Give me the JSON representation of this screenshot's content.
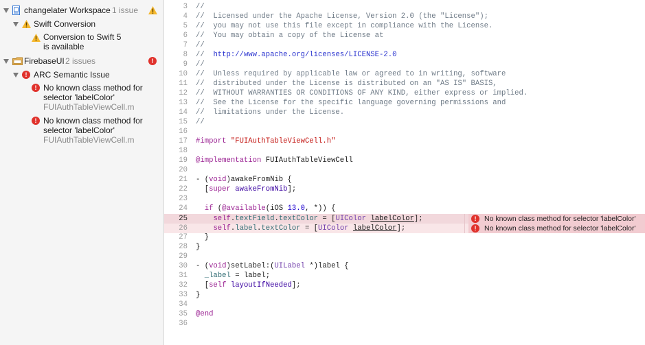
{
  "navigator": {
    "workspace": {
      "name": "changelater Workspace",
      "count": "1 issue"
    },
    "swift_group": {
      "label": "Swift Conversion"
    },
    "swift_item": {
      "line1": "Conversion to Swift 5",
      "line2": "is available"
    },
    "firebase": {
      "name": "FirebaseUI",
      "count": "2 issues"
    },
    "arc_group": {
      "label": "ARC Semantic Issue"
    },
    "issues": [
      {
        "line1": "No known class method for",
        "line2": "selector 'labelColor'",
        "file": "FUIAuthTableViewCell.m"
      },
      {
        "line1": "No known class method for",
        "line2": "selector 'labelColor'",
        "file": "FUIAuthTableViewCell.m"
      }
    ]
  },
  "editor": {
    "lines": [
      "3",
      "4",
      "5",
      "6",
      "7",
      "8",
      "9",
      "10",
      "11",
      "12",
      "13",
      "14",
      "15",
      "16",
      "17",
      "18",
      "19",
      "20",
      "21",
      "22",
      "23",
      "24",
      "25",
      "26",
      "27",
      "28",
      "29",
      "30",
      "31",
      "32",
      "33",
      "34",
      "35",
      "36"
    ],
    "code": {
      "l3": "//",
      "l4": "//  Licensed under the Apache License, Version 2.0 (the \"License\");",
      "l5": "//  you may not use this file except in compliance with the License.",
      "l6": "//  You may obtain a copy of the License at",
      "l7": "//",
      "l8_prefix": "//  ",
      "l8_url": "http://www.apache.org/licenses/LICENSE-2.0",
      "l9": "//",
      "l10": "//  Unless required by applicable law or agreed to in writing, software",
      "l11": "//  distributed under the License is distributed on an \"AS IS\" BASIS,",
      "l12": "//  WITHOUT WARRANTIES OR CONDITIONS OF ANY KIND, either express or implied.",
      "l13": "//  See the License for the specific language governing permissions and",
      "l14": "//  limitations under the License.",
      "l15": "//",
      "import_kw": "#import",
      "import_str": "\"FUIAuthTableViewCell.h\"",
      "impl_kw": "@implementation",
      "impl_name": " FUIAuthTableViewCell",
      "awake_a": "- (",
      "void": "void",
      "awake_b": ")awakeFromNib {",
      "super_indent": "  [",
      "super": "super",
      "space": " ",
      "awakeFromNib": "awakeFromNib",
      "close_semi": "];",
      "if_indent": "  ",
      "if": "if",
      "open_paren": " (",
      "available": "@available",
      "ios_a": "(iOS ",
      "ios_num": "13.0",
      "ios_b": ", *)) {",
      "l25_indent": "    ",
      "self": "self",
      "dot": ".",
      "textField": "textField",
      "textColor": "textColor",
      "eq_bracket": " = [",
      "UIColor": "UIColor",
      "labelColor": "labelColor",
      "label": "label",
      "inner_close": "  }",
      "outer_close": "}",
      "setlabel_b": ")setLabel:(",
      "UILabel": "UILabel",
      "setlabel_c": " *)label {",
      "ivar_indent": "  ",
      "ivar_label": "_label",
      "ivar_rest": " = label;",
      "layoutIfNeeded": "layoutIfNeeded",
      "end": "@end"
    },
    "annotations": [
      {
        "text": "No known class method for selector 'labelColor'"
      },
      {
        "text": "No known class method for selector 'labelColor'"
      }
    ]
  },
  "colors": {
    "error": "#e0322c",
    "warning": "#f5b82e",
    "comment": "#707c88",
    "keyword": "#9b2393",
    "string": "#c41a16"
  },
  "icons": [
    "disclosure-triangle",
    "workspace-icon",
    "warning-icon",
    "error-icon",
    "folder-icon"
  ]
}
